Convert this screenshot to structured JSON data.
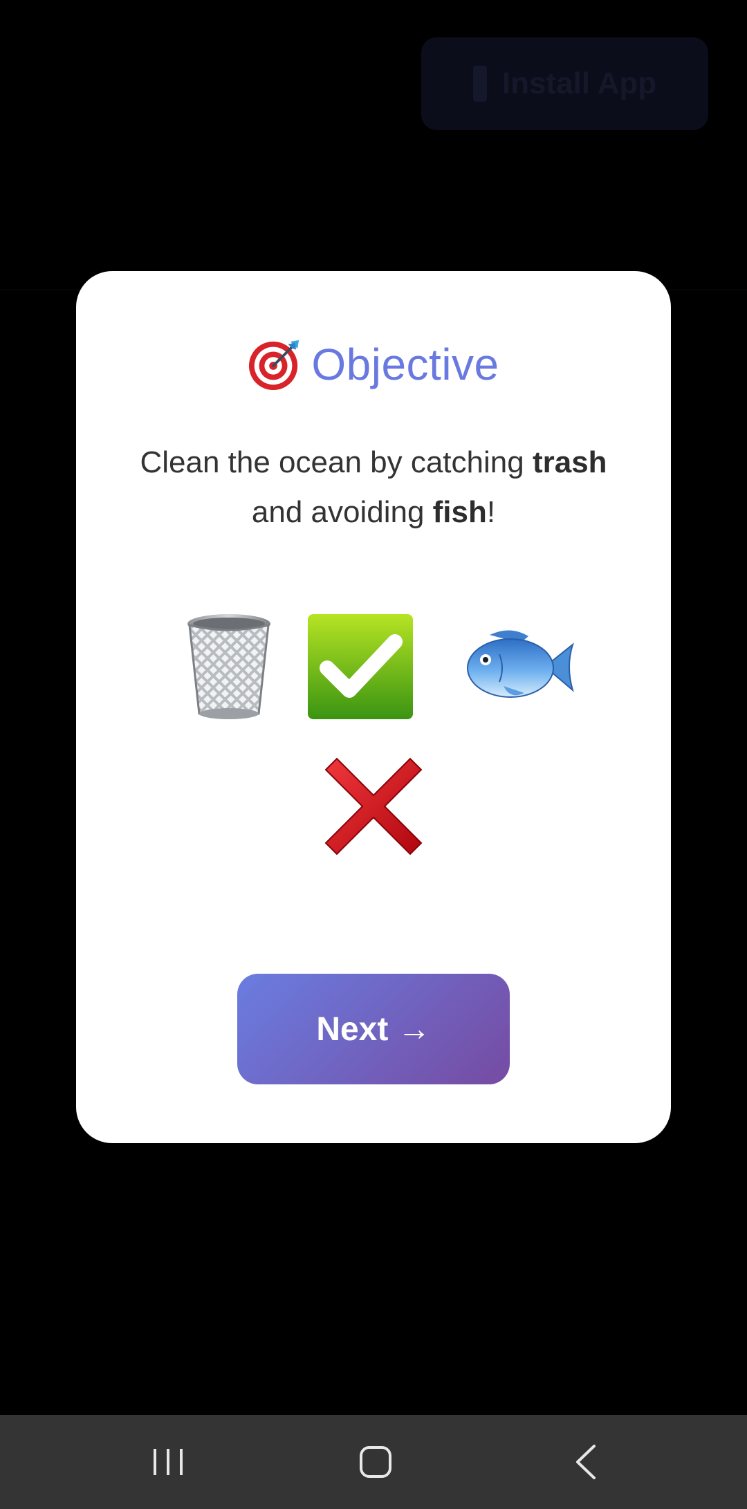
{
  "background": {
    "install_button_label": "Install App"
  },
  "modal": {
    "title": "Objective",
    "description": {
      "part1": "Clean the ocean by catching ",
      "bold1": "trash",
      "part2": " and avoiding ",
      "bold2": "fish",
      "part3": "!"
    },
    "icons": [
      "target-icon",
      "trash-icon",
      "check-icon",
      "fish-icon",
      "cross-icon"
    ],
    "next_button_label": "Next →"
  },
  "nav_bar": {
    "buttons": [
      "recents",
      "home",
      "back"
    ]
  },
  "colors": {
    "title": "#6a79e0",
    "button_gradient_start": "#6a7de0",
    "button_gradient_end": "#764ba2",
    "nav_bar": "#343434"
  }
}
